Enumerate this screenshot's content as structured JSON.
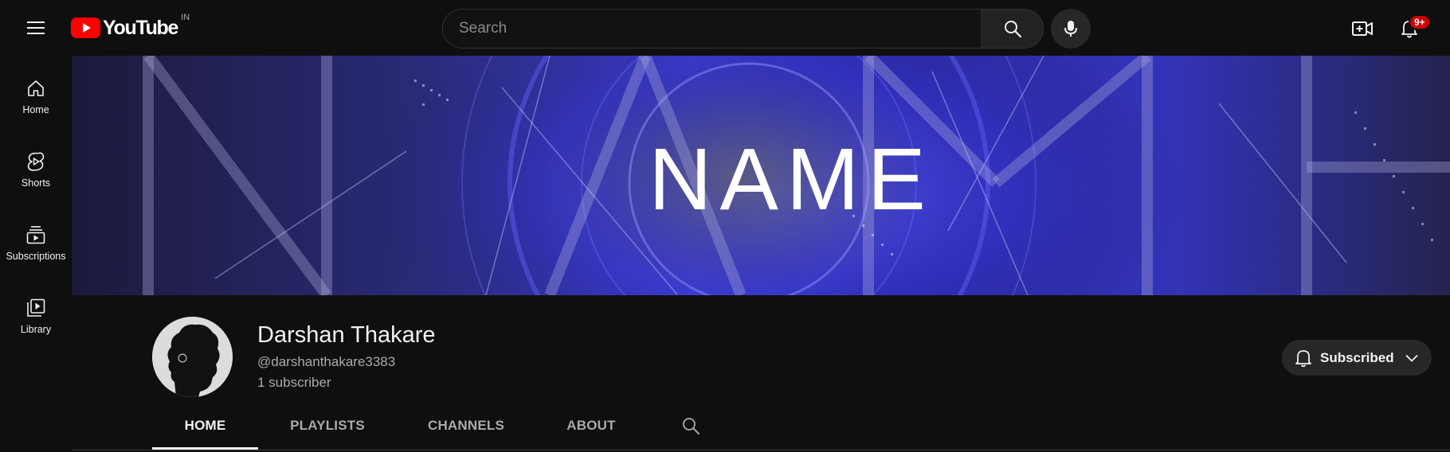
{
  "header": {
    "logo_text": "YouTube",
    "logo_country": "IN",
    "search_placeholder": "Search",
    "notification_count": "9+"
  },
  "guide": {
    "items": [
      {
        "label": "Home",
        "icon": "home-icon"
      },
      {
        "label": "Shorts",
        "icon": "shorts-icon"
      },
      {
        "label": "Subscriptions",
        "icon": "subscriptions-icon"
      },
      {
        "label": "Library",
        "icon": "library-icon"
      }
    ]
  },
  "banner": {
    "text": "NAME"
  },
  "channel": {
    "name": "Darshan Thakare",
    "handle": "@darshanthakare3383",
    "subscribers": "1 subscriber",
    "subscribe_label": "Subscribed"
  },
  "tabs": [
    {
      "label": "HOME",
      "active": true
    },
    {
      "label": "PLAYLISTS",
      "active": false
    },
    {
      "label": "CHANNELS",
      "active": false
    },
    {
      "label": "ABOUT",
      "active": false
    }
  ],
  "colors": {
    "background": "#0f0f0f",
    "accent_red": "#ff0000",
    "badge_red": "#cc0000",
    "text_primary": "#f1f1f1",
    "text_secondary": "#aaaaaa",
    "banner_blue": "#3a3aff"
  }
}
